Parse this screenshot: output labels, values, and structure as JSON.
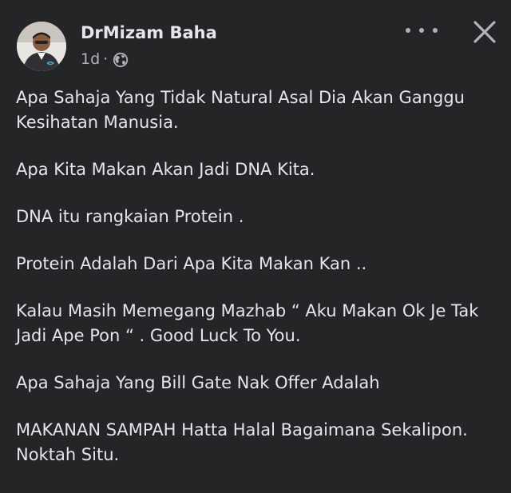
{
  "post": {
    "author": "DrMizam Baha",
    "time": "1d",
    "separator": "·",
    "privacy_icon": "globe-icon",
    "more_icon": "more-horizontal-icon",
    "close_icon": "close-icon",
    "paragraphs": [
      "Apa Sahaja Yang Tidak Natural Asal Dia Akan Ganggu Kesihatan Manusia.",
      "Apa Kita Makan Akan Jadi DNA Kita.",
      "DNA itu rangkaian Protein .",
      "Protein Adalah Dari Apa Kita Makan Kan ..",
      "Kalau Masih Memegang Mazhab “ Aku Makan Ok Je Tak Jadi Ape Pon “ . Good Luck To You.",
      "Apa Sahaja Yang Bill Gate Nak Offer Adalah",
      "MAKANAN SAMPAH Hatta Halal Bagaimana Sekalipon. Noktah Situ."
    ]
  },
  "colors": {
    "background": "#242526",
    "text_primary": "#e4e6eb",
    "text_secondary": "#b0b3b8"
  }
}
